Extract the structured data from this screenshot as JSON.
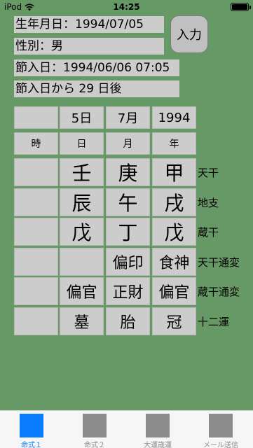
{
  "status": {
    "carrier": "iPod",
    "time": "14:25"
  },
  "info": {
    "birthdate": "生年月日：1994/07/05",
    "gender": "性別：男",
    "setsunyu_date": "節入日：1994/06/06 07:05",
    "days_since": "節入日から 29 日後"
  },
  "input_button": "入力",
  "grid": {
    "header": [
      "",
      "5日",
      "7月",
      "1994"
    ],
    "labels": [
      "時",
      "日",
      "月",
      "年"
    ],
    "tenkan": [
      "",
      "壬",
      "庚",
      "甲"
    ],
    "chishi": [
      "",
      "辰",
      "午",
      "戌"
    ],
    "zoukan": [
      "",
      "戊",
      "丁",
      "戊"
    ],
    "tenkan_tsuhen": [
      "",
      "",
      "偏印",
      "食神"
    ],
    "zoukan_tsuhen": [
      "",
      "偏官",
      "正財",
      "偏官"
    ],
    "juuni_un": [
      "",
      "墓",
      "胎",
      "冠"
    ]
  },
  "row_labels": [
    "天干",
    "地支",
    "蔵干",
    "天干通変",
    "蔵干通変",
    "十二運"
  ],
  "tabs": [
    {
      "label": "命式１",
      "active": true
    },
    {
      "label": "命式２",
      "active": false
    },
    {
      "label": "大運歳運",
      "active": false
    },
    {
      "label": "メール送信",
      "active": false
    }
  ],
  "colors": {
    "background": "#669966",
    "cell": "#cccccc",
    "tab_active": "#0a7cff",
    "tab_inactive": "#8c8c8c"
  }
}
